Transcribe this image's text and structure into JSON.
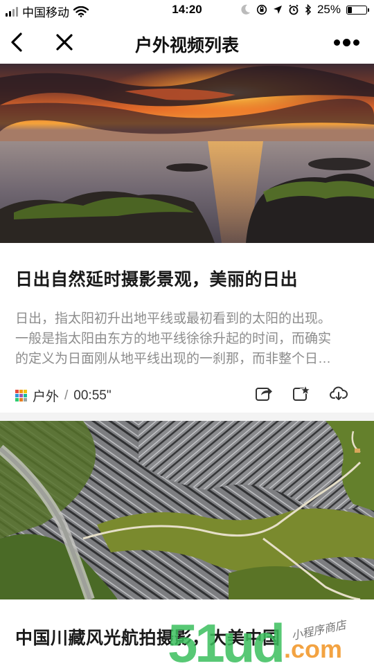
{
  "status": {
    "carrier": "中国移动",
    "time": "14:20",
    "battery": "25%",
    "battery_level": 0.25
  },
  "nav": {
    "title": "户外视频列表",
    "back_icon": "chevron-left-icon",
    "close_icon": "close-icon",
    "more_icon": "more-icon"
  },
  "videos": [
    {
      "title": "日出自然延时摄影景观，美丽的日出",
      "desc_lines": [
        "日出，指太阳初升出地平线或最初看到的太阳的出现。",
        "一般是指太阳由东方的地平线徐徐升起的时间，而确实",
        "的定义为日面刚从地平线出现的一刹那，而非整个日…"
      ],
      "category": "户外",
      "divider": "/",
      "duration": "00:55\""
    },
    {
      "title": "中国川藏风光航拍摄影，大美中国"
    }
  ],
  "watermark": {
    "brand": "51ud",
    "tld": ".com",
    "tagline": "小程序商店"
  },
  "colors": {
    "accent_orange": "#f29a2e",
    "watermark_green": "#3bbf5e"
  }
}
